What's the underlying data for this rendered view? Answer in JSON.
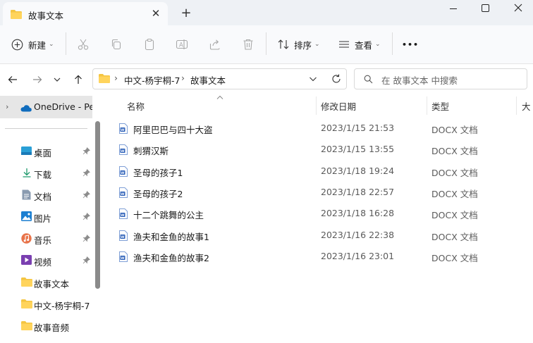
{
  "window": {
    "tab_title": "故事文本",
    "new_tab": "+",
    "close_tab": "✕"
  },
  "toolbar": {
    "new_label": "新建",
    "sort_label": "排序",
    "view_label": "查看",
    "more_label": "•••"
  },
  "address": {
    "segments": [
      "中文-杨宇桐-7",
      "故事文本"
    ],
    "separator": "›"
  },
  "search": {
    "placeholder": "在 故事文本 中搜索"
  },
  "sidebar": {
    "onedrive": "OneDrive - Per",
    "items": [
      {
        "label": "桌面",
        "icon": "desktop-icon",
        "pinned": true
      },
      {
        "label": "下载",
        "icon": "download-icon",
        "pinned": true
      },
      {
        "label": "文档",
        "icon": "document-icon",
        "pinned": true
      },
      {
        "label": "图片",
        "icon": "picture-icon",
        "pinned": true
      },
      {
        "label": "音乐",
        "icon": "music-icon",
        "pinned": true
      },
      {
        "label": "视频",
        "icon": "video-icon",
        "pinned": true
      },
      {
        "label": "故事文本",
        "icon": "folder-icon",
        "pinned": false
      },
      {
        "label": "中文-杨宇桐-7",
        "icon": "folder-icon",
        "pinned": false
      },
      {
        "label": "故事音频",
        "icon": "folder-icon",
        "pinned": false
      }
    ]
  },
  "list": {
    "columns": [
      "名称",
      "修改日期",
      "类型",
      "大"
    ],
    "rows": [
      {
        "name": "阿里巴巴与四十大盗",
        "date": "2023/1/15 21:53",
        "type": "DOCX 文档"
      },
      {
        "name": "刺猬汉斯",
        "date": "2023/1/15 13:55",
        "type": "DOCX 文档"
      },
      {
        "name": "圣母的孩子1",
        "date": "2023/1/18 19:24",
        "type": "DOCX 文档"
      },
      {
        "name": "圣母的孩子2",
        "date": "2023/1/18 22:57",
        "type": "DOCX 文档"
      },
      {
        "name": "十二个跳舞的公主",
        "date": "2023/1/18 16:28",
        "type": "DOCX 文档"
      },
      {
        "name": "渔夫和金鱼的故事1",
        "date": "2023/1/16 22:38",
        "type": "DOCX 文档"
      },
      {
        "name": "渔夫和金鱼的故事2",
        "date": "2023/1/16 23:01",
        "type": "DOCX 文档"
      }
    ]
  },
  "colors": {
    "folder": "#f4c542",
    "accent": "#0067c0",
    "docx": "#2b5fb8",
    "onedrive": "#0f6cbd"
  }
}
